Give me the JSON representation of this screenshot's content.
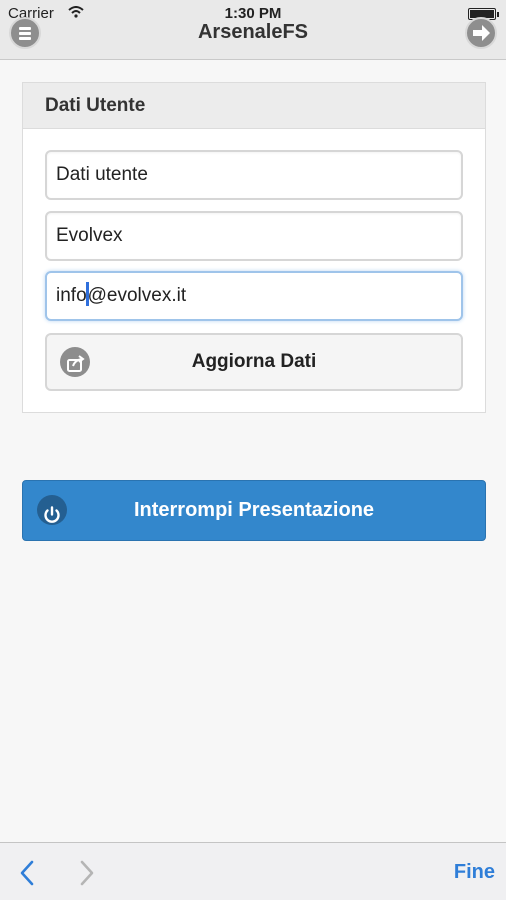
{
  "status": {
    "carrier": "Carrier",
    "time": "1:30 PM"
  },
  "nav": {
    "title": "ArsenaleFS"
  },
  "card": {
    "header": "Dati Utente",
    "fields": [
      "Dati utente",
      "Evolvex",
      "info@evolvex.it"
    ],
    "email_before_caret": "info",
    "email_after_caret": "@evolvex.it",
    "update_label": "Aggiorna Dati"
  },
  "stop_label": "Interrompi Presentazione",
  "toolbar": {
    "done_label": "Fine"
  },
  "colors": {
    "accent": "#3387cc",
    "link": "#2f7ed8"
  }
}
